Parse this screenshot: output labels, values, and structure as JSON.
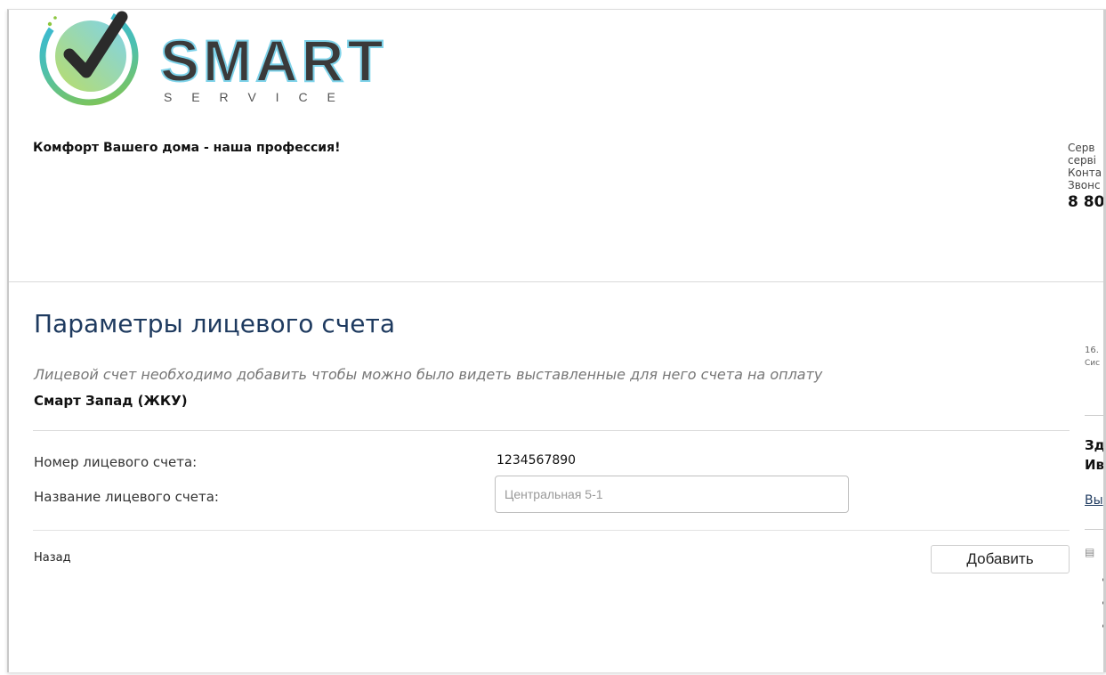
{
  "brand": {
    "name": "SMART",
    "sub": "S E R V I C E",
    "colors": {
      "primary": "#3a3a3a",
      "accent_green": "#8cc63f",
      "accent_blue": "#2fb4e6"
    }
  },
  "header": {
    "tagline": "Комфорт Вашего дома - наша профессия!",
    "contacts": {
      "line1": "Серв",
      "line2": "серві",
      "line3": "Конта",
      "line4": "Звонс",
      "phone": "8 80"
    }
  },
  "main": {
    "title": "Параметры лицевого счета",
    "note": "Лицевой счет необходимо добавить чтобы можно было видеть выставленные для него счета на оплату",
    "provider": "Смарт Запад (ЖКУ)",
    "fields": {
      "account_number_label": "Номер лицевого счета:",
      "account_number_value": "1234567890",
      "account_name_label": "Название лицевого счета:",
      "account_name_placeholder": "Центральная 5-1"
    },
    "actions": {
      "back": "Назад",
      "add": "Добавить"
    }
  },
  "sidebar": {
    "date": "16.",
    "date_sub": "Сис",
    "greeting_line1": "Зд",
    "greeting_line2": "Ив",
    "logout": "Вы",
    "icon": "calendar-icon"
  }
}
